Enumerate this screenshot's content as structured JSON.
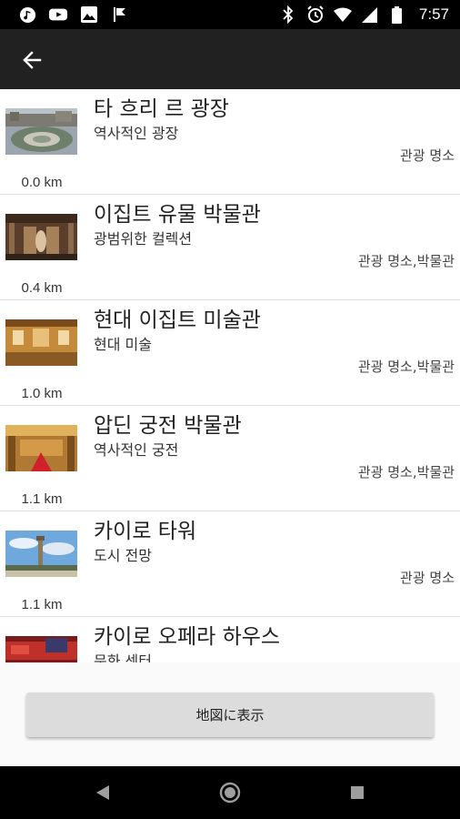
{
  "status_bar": {
    "time": "7:57",
    "left_icons": [
      "music-app-icon",
      "youtube-icon",
      "image-icon",
      "flag-app-icon"
    ],
    "right_icons": [
      "bluetooth-icon",
      "alarm-icon",
      "wifi-icon",
      "signal-icon",
      "battery-icon"
    ]
  },
  "app_bar": {
    "back_icon": "arrow-left-icon"
  },
  "places": [
    {
      "title": "타 흐리 르 광장",
      "subtitle": "역사적인 광장",
      "category": "관광 명소",
      "distance": "0.0 km"
    },
    {
      "title": "이집트 유물 박물관",
      "subtitle": "광범위한 컬렉션",
      "category": "관광 명소,박물관",
      "distance": "0.4 km"
    },
    {
      "title": "현대 이집트 미술관",
      "subtitle": "현대 미술",
      "category": "관광 명소,박물관",
      "distance": "1.0 km"
    },
    {
      "title": "압딘 궁전 박물관",
      "subtitle": "역사적인 궁전",
      "category": "관광 명소,박물관",
      "distance": "1.1 km"
    },
    {
      "title": "카이로 타워",
      "subtitle": "도시 전망",
      "category": "관광 명소",
      "distance": "1.1 km"
    },
    {
      "title": "카이로 오페라 하우스",
      "subtitle": "문화 센터",
      "category": "",
      "distance": ""
    }
  ],
  "map_button": {
    "label": "地図に表示"
  },
  "nav_bar": {
    "icons": [
      "back-triangle-icon",
      "home-circle-icon",
      "recents-square-icon"
    ]
  }
}
